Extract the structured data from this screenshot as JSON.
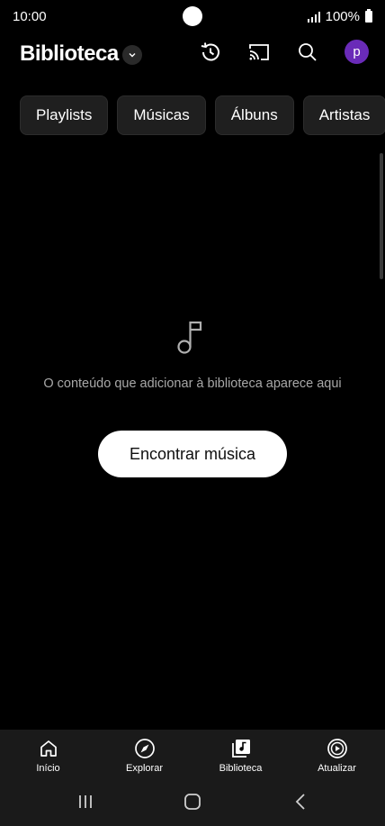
{
  "status": {
    "time": "10:00",
    "battery": "100%"
  },
  "header": {
    "title": "Biblioteca",
    "avatar_letter": "p"
  },
  "chips": [
    "Playlists",
    "Músicas",
    "Álbuns",
    "Artistas"
  ],
  "empty_state": {
    "message": "O conteúdo que adicionar à biblioteca aparece aqui",
    "button": "Encontrar música"
  },
  "bottom_nav": {
    "items": [
      {
        "label": "Início",
        "icon": "home-icon"
      },
      {
        "label": "Explorar",
        "icon": "compass-icon"
      },
      {
        "label": "Biblioteca",
        "icon": "library-icon"
      },
      {
        "label": "Atualizar",
        "icon": "upgrade-icon"
      }
    ]
  },
  "colors": {
    "background": "#000000",
    "avatar": "#6a2bb8",
    "nav_background": "#1a1a1a"
  }
}
